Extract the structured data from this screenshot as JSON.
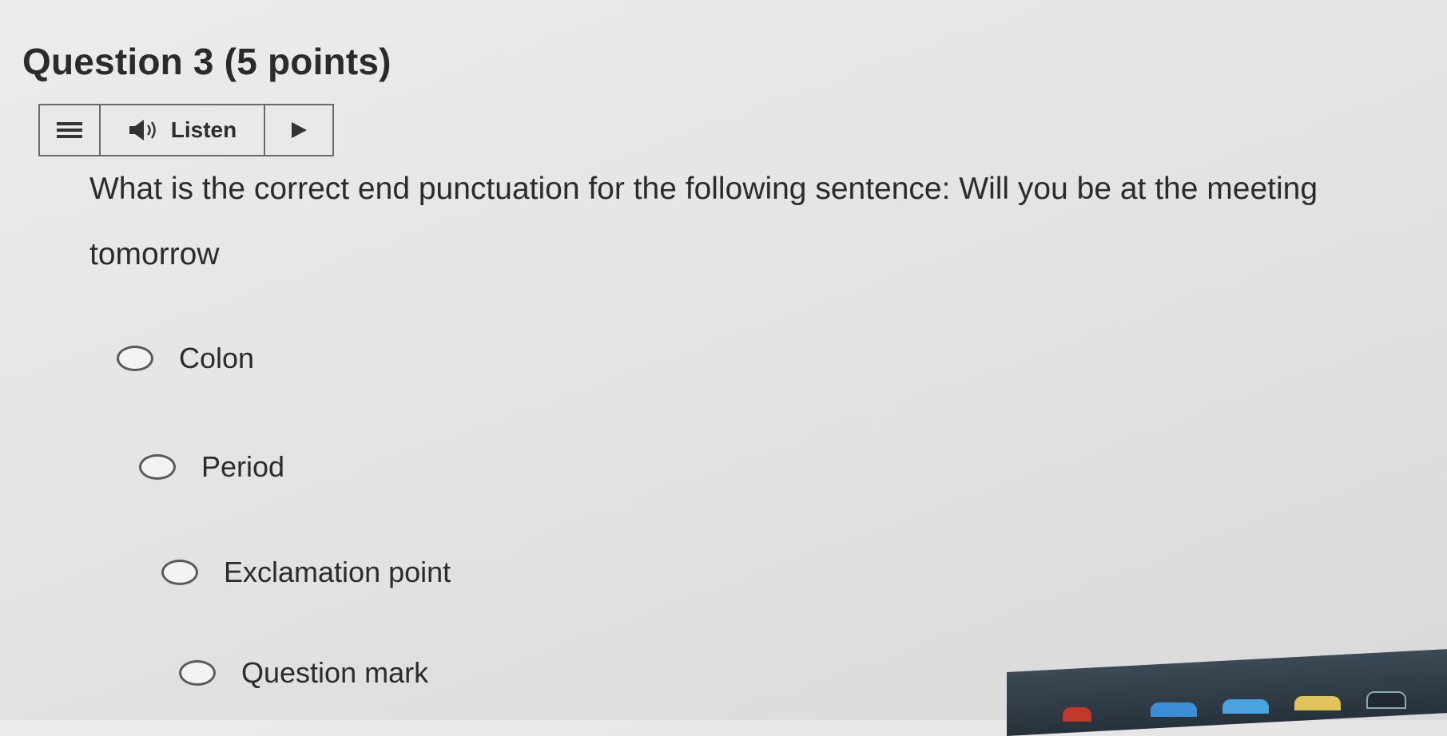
{
  "question": {
    "title": "Question 3 (5 points)",
    "text": "What is the correct end punctuation for the following sentence: Will you be at the meeting tomorrow"
  },
  "toolbar": {
    "menu_icon": "hamburger-menu-icon",
    "speaker_icon": "speaker-icon",
    "listen_label": "Listen",
    "play_icon": "play-icon"
  },
  "options": [
    {
      "label": "Colon",
      "selected": false
    },
    {
      "label": "Period",
      "selected": false
    },
    {
      "label": "Exclamation point",
      "selected": false
    },
    {
      "label": "Question mark",
      "selected": false
    }
  ],
  "colors": {
    "background": "#e6e6e6",
    "text": "#2b2b2b",
    "border": "#6a6a6a"
  }
}
